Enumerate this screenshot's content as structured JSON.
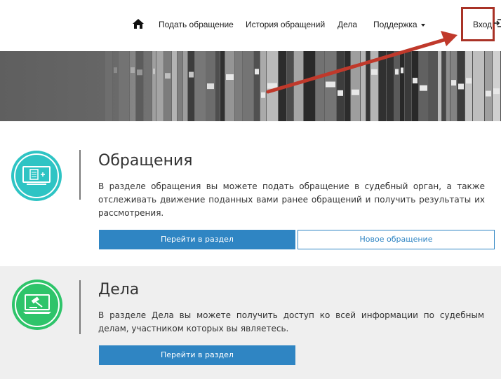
{
  "nav": {
    "home_icon": "home-icon",
    "items": [
      {
        "label": "Подать обращение"
      },
      {
        "label": "История обращений"
      },
      {
        "label": "Дела"
      },
      {
        "label": "Поддержка"
      }
    ],
    "login_label": "Вход",
    "login_icon": "login-icon"
  },
  "annotation": {
    "arrow_color": "#c0392b",
    "box_color": "#a93226"
  },
  "sections": [
    {
      "icon": "document-screen-icon",
      "icon_color": "#2ec4c4",
      "title": "Обращения",
      "text": "В разделе обращения вы можете подать обращение в судебный орган, а также отслеживать движение поданных вами ранее обращений и получить результаты их рассмотрения.",
      "primary_button": "Перейти в раздел",
      "secondary_button": "Новое обращение"
    },
    {
      "icon": "gavel-screen-icon",
      "icon_color": "#2ec46a",
      "title": "Дела",
      "text": "В разделе Дела вы можете получить доступ ко всей информации по судебным делам, участником которых вы являетесь.",
      "primary_button": "Перейти в раздел"
    }
  ],
  "colors": {
    "primary": "#2f85c3",
    "teal": "#2ec4c4",
    "green": "#2ec46a"
  }
}
